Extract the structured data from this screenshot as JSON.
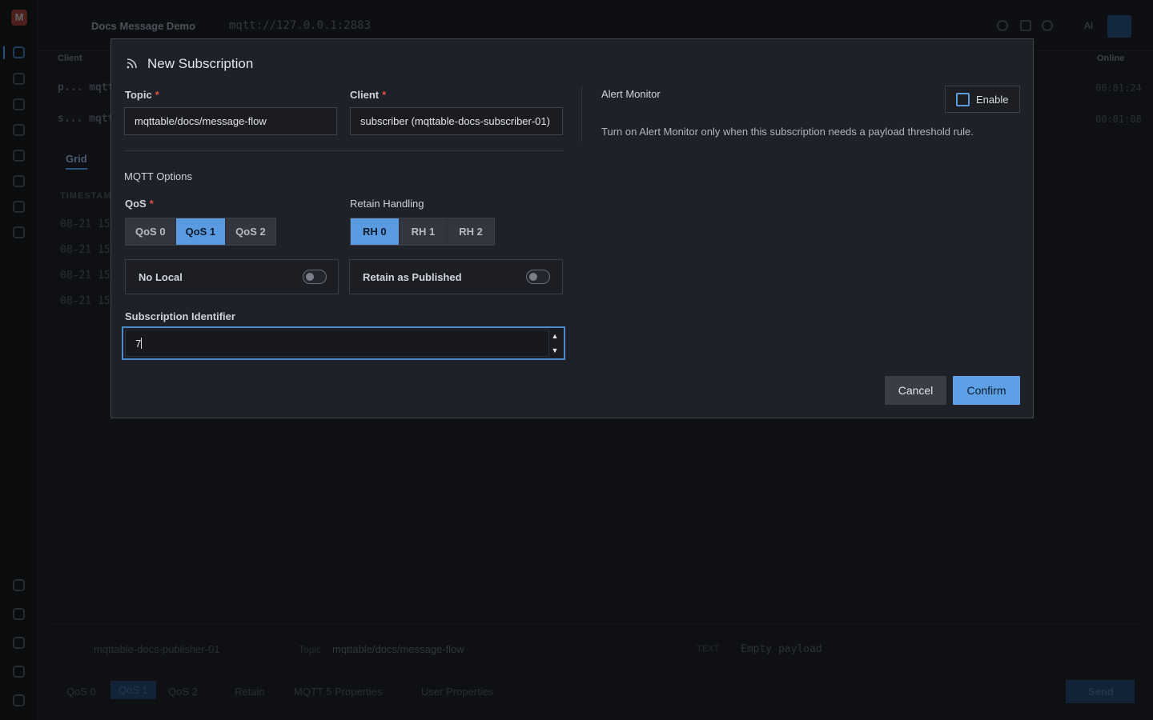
{
  "app": {
    "workspace_name": "Docs Message Demo",
    "broker_url": "mqtt://127.0.0.1:2883",
    "ai_label": "AI"
  },
  "connections": {
    "col_client": "Client",
    "col_online": "Online",
    "rows": [
      {
        "name": "p... mqtta",
        "online": "00:01:24"
      },
      {
        "name": "s... mqtta",
        "online": "00:01:08"
      }
    ]
  },
  "messages": {
    "tab_grid": "Grid",
    "col_timestamp": "TIMESTAM",
    "rows": [
      "08-21 15",
      "08-21 15",
      "08-21 15",
      "08-21 15"
    ]
  },
  "composer": {
    "client": "mqttable-docs-publisher-01",
    "topic_label": "Topic",
    "topic": "mqttable/docs/message-flow",
    "format_label": "TEXT",
    "payload_placeholder": "Empty payload",
    "qos_options": [
      "QoS 0",
      "QoS 1",
      "QoS 2"
    ],
    "retain_label": "Retain",
    "mqtt5_label": "MQTT 5 Properties",
    "user_props_label": "User Properties",
    "send_label": "Send"
  },
  "modal": {
    "title": "New Subscription",
    "topic_label": "Topic",
    "topic_value": "mqttable/docs/message-flow",
    "client_label": "Client",
    "client_value": "subscriber (mqttable-docs-subscriber-01)",
    "mqtt_options_label": "MQTT Options",
    "qos_label": "QoS",
    "qos_options": [
      "QoS 0",
      "QoS 1",
      "QoS 2"
    ],
    "qos_selected": "QoS 1",
    "retain_handling_label": "Retain Handling",
    "rh_options": [
      "RH 0",
      "RH 1",
      "RH 2"
    ],
    "rh_selected": "RH 0",
    "no_local_label": "No Local",
    "no_local_on": false,
    "retain_as_published_label": "Retain as Published",
    "retain_as_published_on": false,
    "sub_id_label": "Subscription Identifier",
    "sub_id_value": "7",
    "alert_monitor_label": "Alert Monitor",
    "enable_label": "Enable",
    "enable_checked": false,
    "alert_description": "Turn on Alert Monitor only when this subscription needs a payload threshold rule.",
    "cancel_label": "Cancel",
    "confirm_label": "Confirm",
    "required_mark": "*"
  },
  "colors": {
    "accent": "#5ea0e6",
    "required": "#e0544a",
    "modal_bg": "#1f2128"
  }
}
